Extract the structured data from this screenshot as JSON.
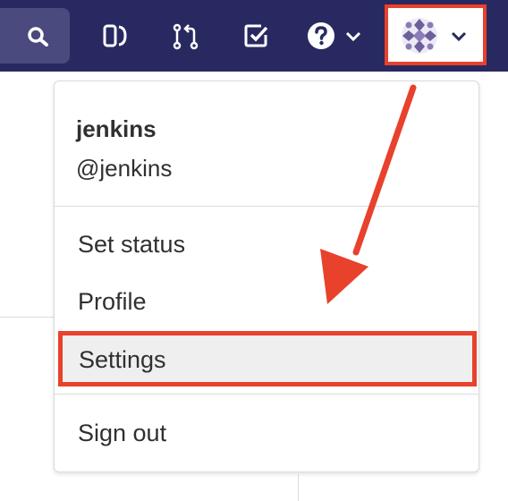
{
  "navbar": {
    "icons": [
      "search-icon",
      "issues-icon",
      "merge-requests-icon",
      "todos-icon",
      "help-icon",
      "user-avatar"
    ],
    "accent": "#292961"
  },
  "dropdown": {
    "user_name": "jenkins",
    "user_handle": "@jenkins",
    "items": [
      {
        "label": "Set status"
      },
      {
        "label": "Profile"
      },
      {
        "label": "Settings"
      },
      {
        "label": "Sign out"
      }
    ],
    "highlighted_item": "Settings"
  },
  "annotation": {
    "color": "#e8412c"
  }
}
